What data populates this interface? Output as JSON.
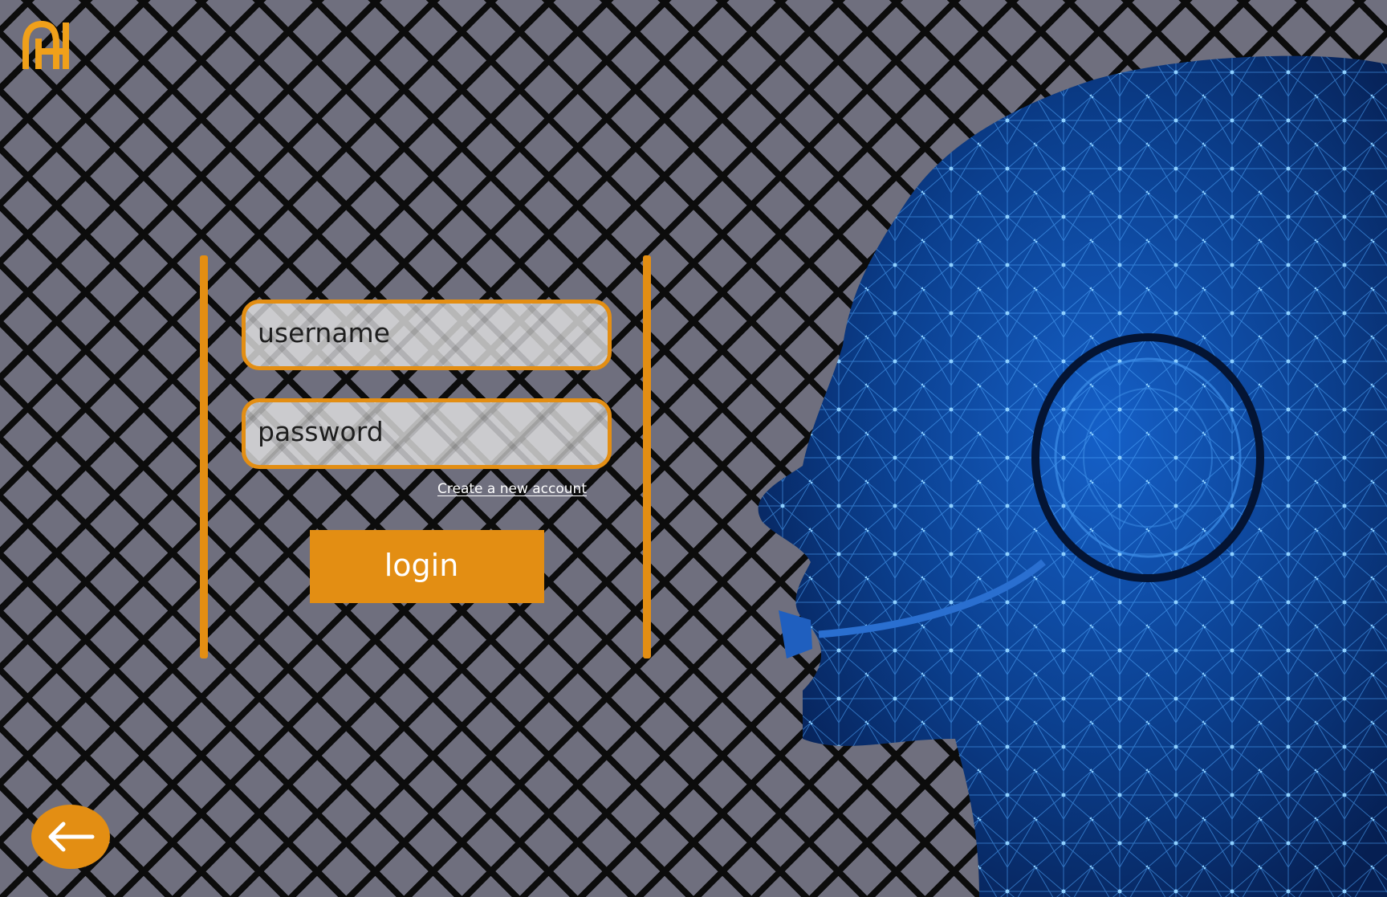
{
  "brand": {
    "logo_icon": "monogram-logo-icon",
    "accent_color": "#e38e13",
    "background_color": "#6f6f7e"
  },
  "login_form": {
    "username_placeholder": "username",
    "password_placeholder": "password",
    "create_account_link": "Create a new account",
    "login_button_label": "login"
  },
  "navigation": {
    "back_icon": "arrow-left-icon"
  },
  "hero": {
    "image_icon": "ai-headset-head-icon",
    "image_color": "#0d4fa8"
  }
}
